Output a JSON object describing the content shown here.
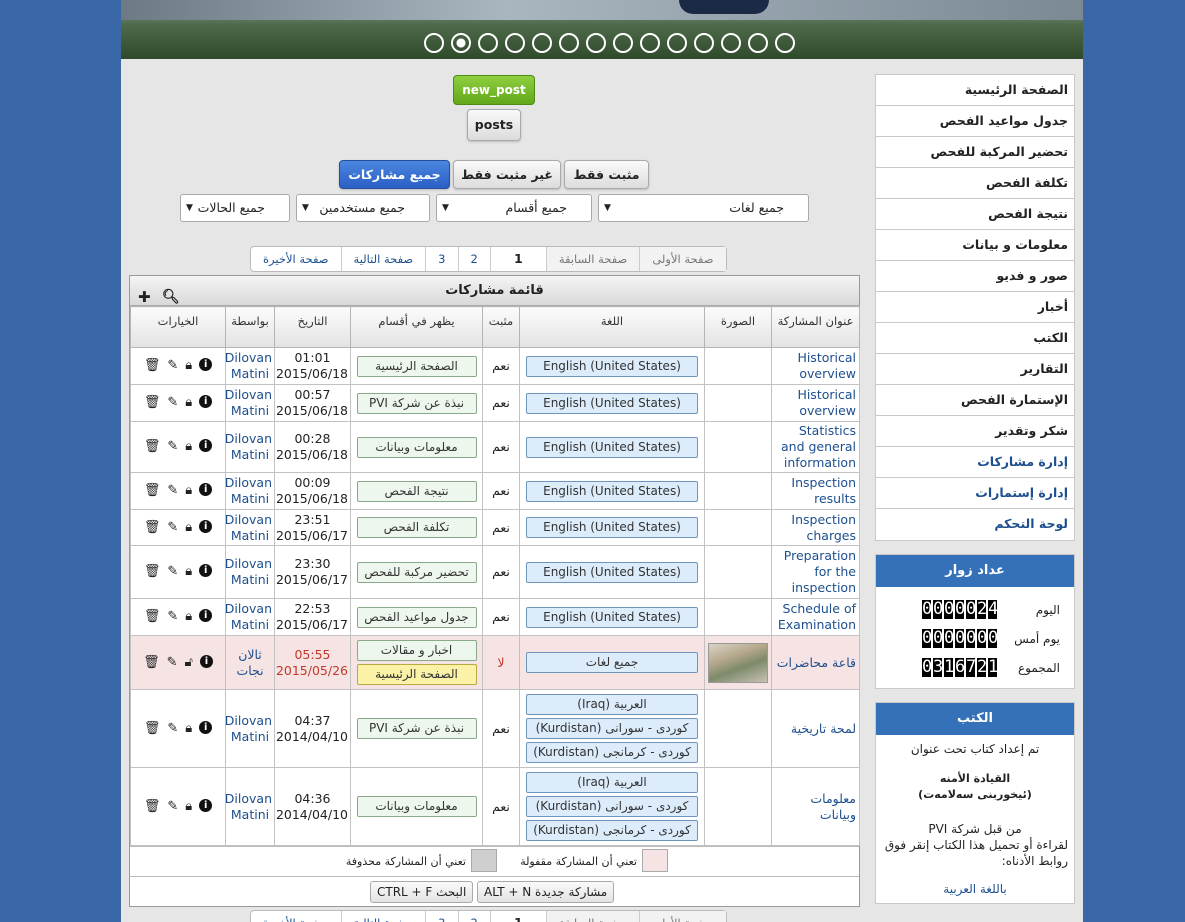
{
  "slider": {
    "dot_count": 14,
    "active_index": 1
  },
  "buttons": {
    "new_post": "new_post",
    "posts": "posts"
  },
  "filters": {
    "pinned_only": "مثبت فقط",
    "unpinned_only": "غير مثبت فقط",
    "all_posts": "جميع مشاركات"
  },
  "selects": {
    "languages": "جميع لغات",
    "sections": "جميع أقسام",
    "users": "جميع مستخدمين",
    "states": "جميع الحالات"
  },
  "pager": {
    "first": "صفحة الأولى",
    "prev": "صفحة السابقة",
    "p1": "1",
    "p2": "2",
    "p3": "3",
    "next": "صفحة التالية",
    "last": "صفحة الأخيرة"
  },
  "list": {
    "title": "قائمة مشاركات",
    "headers": {
      "title": "عنوان المشاركة",
      "image": "الصورة",
      "language": "اللغة",
      "pinned": "مثبت",
      "sections": "يظهر في أقسام",
      "date": "التاريخ",
      "by": "بواسطة",
      "options": "الخيارات"
    },
    "rows": [
      {
        "title": "Historical overview",
        "langs": [
          "English (United States)"
        ],
        "pinned": "نعم",
        "sections": [
          "الصفحة الرئيسية"
        ],
        "time": "01:01",
        "date": "2015/06/18",
        "by": "Dilovan Matini"
      },
      {
        "title": "Historical overview",
        "langs": [
          "English (United States)"
        ],
        "pinned": "نعم",
        "sections": [
          "نبذة عن شركة PVI"
        ],
        "time": "00:57",
        "date": "2015/06/18",
        "by": "Dilovan Matini"
      },
      {
        "title": "Statistics and general information",
        "langs": [
          "English (United States)"
        ],
        "pinned": "نعم",
        "sections": [
          "معلومات وبيانات"
        ],
        "time": "00:28",
        "date": "2015/06/18",
        "by": "Dilovan Matini"
      },
      {
        "title": "Inspection results",
        "langs": [
          "English (United States)"
        ],
        "pinned": "نعم",
        "sections": [
          "نتيجة الفحص"
        ],
        "time": "00:09",
        "date": "2015/06/18",
        "by": "Dilovan Matini"
      },
      {
        "title": "Inspection charges",
        "langs": [
          "English (United States)"
        ],
        "pinned": "نعم",
        "sections": [
          "تكلفة الفحص"
        ],
        "time": "23:51",
        "date": "2015/06/17",
        "by": "Dilovan Matini"
      },
      {
        "title": "Preparation for the inspection",
        "langs": [
          "English (United States)"
        ],
        "pinned": "نعم",
        "sections": [
          "تحضير مركبة للفحص"
        ],
        "time": "23:30",
        "date": "2015/06/17",
        "by": "Dilovan Matini"
      },
      {
        "title": "Schedule of Examination",
        "langs": [
          "English (United States)"
        ],
        "pinned": "نعم",
        "sections": [
          "جدول مواعيد الفحص"
        ],
        "time": "22:53",
        "date": "2015/06/17",
        "by": "Dilovan Matini"
      },
      {
        "title": "قاعة محاضرات",
        "langs": [
          "جميع لغات"
        ],
        "pinned": "لا",
        "sections": [
          "اخبار و مقالات",
          "الصفحة الرئيسية"
        ],
        "time": "05:55",
        "date": "2015/05/26",
        "by": "ثالان نجات",
        "locked": true,
        "image": true
      },
      {
        "title": "لمحة تاريخية",
        "langs": [
          "العربية (Iraq)",
          "كوردى - سورانى (Kurdistan)",
          "كوردى - كرمانجى (Kurdistan)"
        ],
        "pinned": "نعم",
        "sections": [
          "نبذة عن شركة PVI"
        ],
        "time": "04:37",
        "date": "2014/04/10",
        "by": "Dilovan Matini"
      },
      {
        "title": "معلومات وبيانات",
        "langs": [
          "العربية (Iraq)",
          "كوردى - سورانى (Kurdistan)",
          "كوردى - كرمانجى (Kurdistan)"
        ],
        "pinned": "نعم",
        "sections": [
          "معلومات وبيانات"
        ],
        "time": "04:36",
        "date": "2014/04/10",
        "by": "Dilovan Matini"
      }
    ]
  },
  "legend": {
    "locked": "تعني أن المشاركة مقفولة",
    "deleted": "تعني أن المشاركة محذوفة"
  },
  "shortcuts": {
    "new_post": "مشاركة جديدة ALT + N",
    "search": "البحث CTRL + F"
  },
  "menu": [
    "الصفحة الرئيسية",
    "جدول مواعيد الفحص",
    "تحضير المركبة للفحص",
    "تكلفة الفحص",
    "نتيجة الفحص",
    "معلومات و بيانات",
    "صور و فديو",
    "أخبار",
    "الكتب",
    "التقارير",
    "الإستمارة الفحص",
    "شكر وتقدير",
    "إدارة مشاركات",
    "إدارة إستمارات",
    "لوحة التحكم"
  ],
  "counter": {
    "title": "عداد زوار",
    "today_label": "اليوم",
    "today": "0000024",
    "yesterday_label": "يوم أمس",
    "yesterday": "0000000",
    "total_label": "المجموع",
    "total": "0316721"
  },
  "books": {
    "title": "الكتب",
    "line1": "تم إعداد كتاب تحت عنوان",
    "book_name": "القيادة الأمنه",
    "book_name2": "(ئيخوربنى سەلامەت)",
    "by": "من قبل شركة PVI",
    "instr": "لقراءة أو تحميل هذا الكتاب إنقر فوق روابط الأدناه:",
    "link_ar": "باللغة العربية"
  },
  "colors": {
    "page_bg": "#3a67a8",
    "accent_blue": "#3471b9",
    "new_post_green": "#7cbf2e",
    "link": "#1d4f8f",
    "locked_row": "#f6e3e3"
  }
}
